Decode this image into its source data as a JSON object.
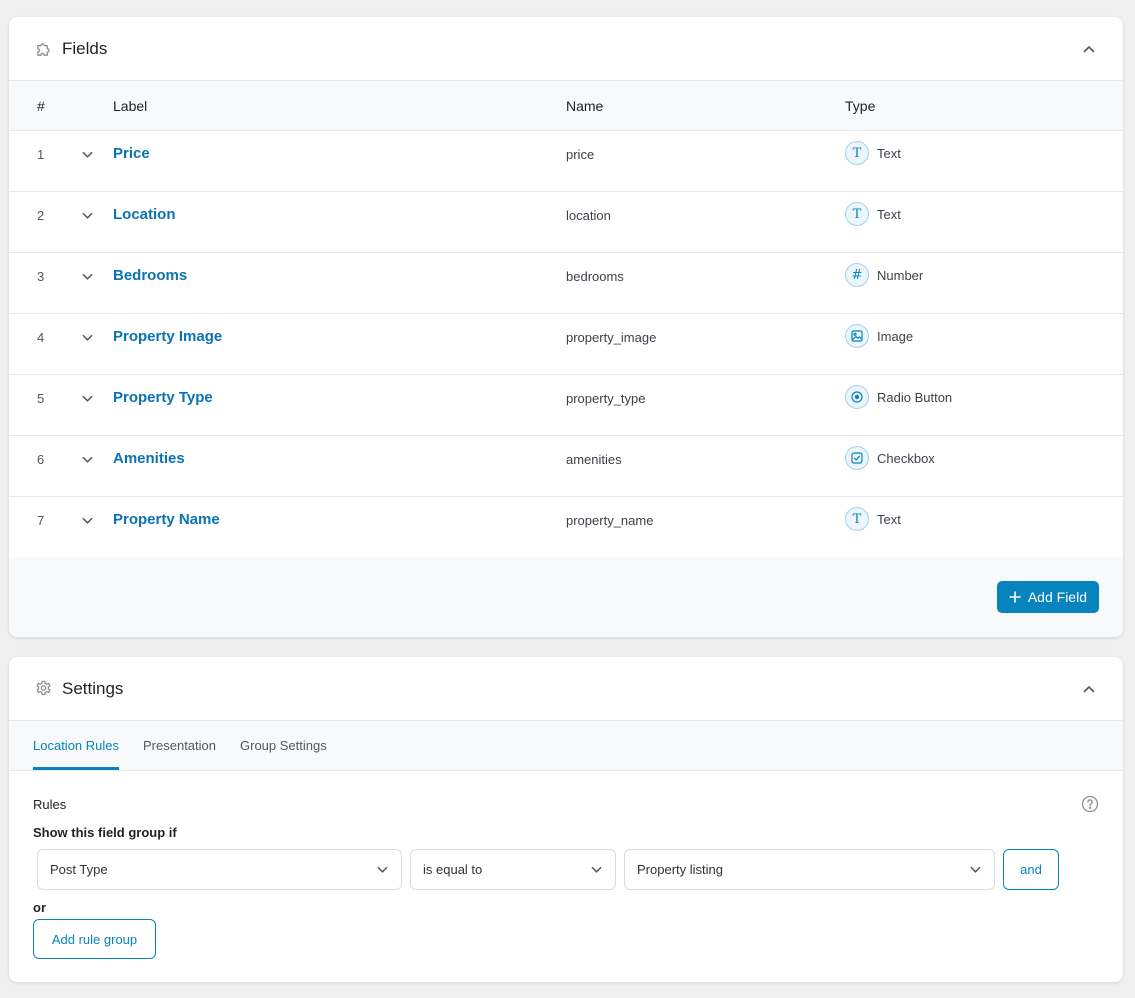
{
  "fields_panel": {
    "title": "Fields",
    "icon": "puzzle-icon",
    "columns": {
      "num": "#",
      "label": "Label",
      "name": "Name",
      "type": "Type"
    },
    "rows": [
      {
        "num": "1",
        "label": "Price",
        "name": "price",
        "type": "Text",
        "type_icon": "T"
      },
      {
        "num": "2",
        "label": "Location",
        "name": "location",
        "type": "Text",
        "type_icon": "T"
      },
      {
        "num": "3",
        "label": "Bedrooms",
        "name": "bedrooms",
        "type": "Number",
        "type_icon": "#"
      },
      {
        "num": "4",
        "label": "Property Image",
        "name": "property_image",
        "type": "Image",
        "type_icon": "image"
      },
      {
        "num": "5",
        "label": "Property Type",
        "name": "property_type",
        "type": "Radio Button",
        "type_icon": "radio"
      },
      {
        "num": "6",
        "label": "Amenities",
        "name": "amenities",
        "type": "Checkbox",
        "type_icon": "checkbox"
      },
      {
        "num": "7",
        "label": "Property Name",
        "name": "property_name",
        "type": "Text",
        "type_icon": "T"
      }
    ],
    "add_field_label": "Add Field"
  },
  "settings_panel": {
    "title": "Settings",
    "icon": "gear-icon",
    "tabs": [
      {
        "label": "Location Rules",
        "active": true
      },
      {
        "label": "Presentation",
        "active": false
      },
      {
        "label": "Group Settings",
        "active": false
      }
    ],
    "rules_title": "Rules",
    "show_if": "Show this field group if",
    "rule": {
      "param": "Post Type",
      "operator": "is equal to",
      "value": "Property listing"
    },
    "and_label": "and",
    "or_label": "or",
    "add_rule_group_label": "Add rule group"
  },
  "colors": {
    "accent": "#0783be",
    "link": "#0a73b0",
    "background": "#f0f0f1"
  }
}
